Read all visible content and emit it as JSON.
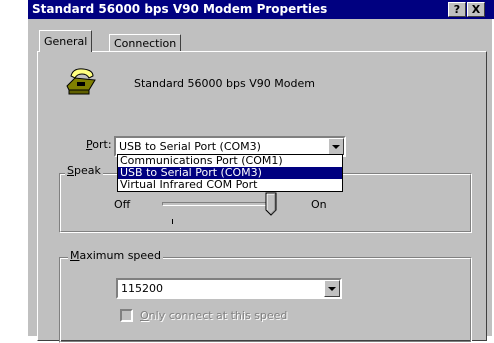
{
  "window": {
    "title": "Standard 56000 bps V90 Modem Properties",
    "help_label": "?",
    "close_label": "X"
  },
  "tabs": [
    {
      "label": "General",
      "active": true
    },
    {
      "label": "Connection",
      "active": false
    }
  ],
  "general": {
    "modem_name": "Standard 56000 bps V90 Modem",
    "port": {
      "label_accel": "P",
      "label_rest": "ort:",
      "selected": "USB to Serial Port (COM3)",
      "options": [
        "Communications Port (COM1)",
        "USB to Serial Port (COM3)",
        "Virtual Infrared COM Port"
      ]
    },
    "speaker": {
      "caption_accel": "S",
      "caption_rest": "peak",
      "off_label": "Off",
      "on_label": "On",
      "volume_fraction": 0.9
    },
    "speed": {
      "caption_accel": "M",
      "caption_rest": "aximum speed",
      "selected": "115200",
      "only_connect_accel": "O",
      "only_connect_rest": "nly connect at this speed",
      "only_connect_checked": false
    }
  },
  "colors": {
    "titlebar": "#000080",
    "face": "#c0c0c0",
    "selection": "#000080"
  }
}
